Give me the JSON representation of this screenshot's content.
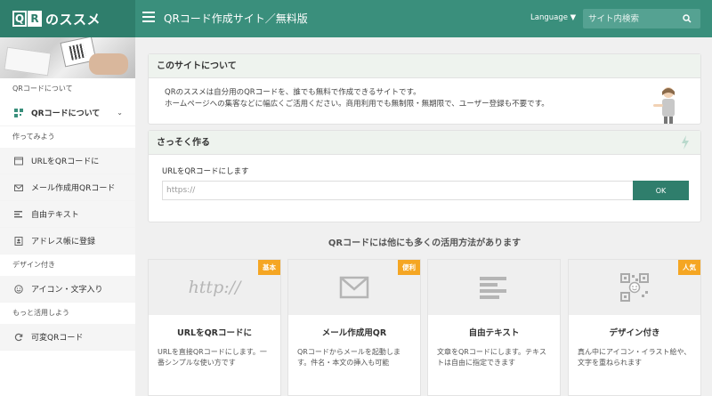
{
  "header": {
    "logo": {
      "q": "Q",
      "r": "R",
      "text": "のススメ"
    },
    "title": "QRコード作成サイト／無料版",
    "language": "Language ▼",
    "search_placeholder": "サイト内検索"
  },
  "sidebar": {
    "sections": [
      {
        "label": "QRコードについて",
        "items": [
          {
            "label": "QRコードについて",
            "icon": "qr-grid-icon",
            "chevron": "⌄"
          }
        ]
      },
      {
        "label": "作ってみよう",
        "items": [
          {
            "label": "URLをQRコードに",
            "icon": "browser-window-icon"
          },
          {
            "label": "メール作成用QRコード",
            "icon": "envelope-icon"
          },
          {
            "label": "自由テキスト",
            "icon": "text-lines-icon"
          },
          {
            "label": "アドレス帳に登録",
            "icon": "address-book-icon"
          }
        ]
      },
      {
        "label": "デザイン付き",
        "items": [
          {
            "label": "アイコン・文字入り",
            "icon": "smiley-icon"
          }
        ]
      },
      {
        "label": "もっと活用しよう",
        "items": [
          {
            "label": "可変QRコード",
            "icon": "refresh-icon"
          }
        ]
      }
    ]
  },
  "about": {
    "title": "このサイトについて",
    "lines": [
      "QRのススメは自分用のQRコードを、誰でも無料で作成できるサイトです。",
      "ホームページへの集客などに幅広くご活用ください。商用利用でも無制限・無期限で、ユーザー登録も不要です。"
    ]
  },
  "quick": {
    "title": "さっそく作る",
    "label": "URLをQRコードにします",
    "placeholder": "https://",
    "button": "OK"
  },
  "uses_title": "QRコードには他にも多くの活用方法があります",
  "features": [
    {
      "badge": "基本",
      "pic_text": "http://",
      "icon": "http-text-icon",
      "title": "URLをQRコードに",
      "desc": "URLを直接QRコードにします。一番シンプルな使い方です"
    },
    {
      "badge": "便利",
      "icon": "envelope-icon",
      "title": "メール作成用QR",
      "desc": "QRコードからメールを起動します。件名・本文の挿入も可能"
    },
    {
      "badge": "",
      "icon": "text-lines-icon",
      "title": "自由テキスト",
      "desc": "文章をQRコードにします。テキストは自由に指定できます"
    },
    {
      "badge": "人気",
      "icon": "qr-smiley-icon",
      "title": "デザイン付き",
      "desc": "真ん中にアイコン・イラスト絵や、文字を重ねられます"
    }
  ],
  "colors": {
    "brand": "#3a8f7c",
    "brand_dark": "#2f7e6c",
    "badge": "#f5a623"
  }
}
